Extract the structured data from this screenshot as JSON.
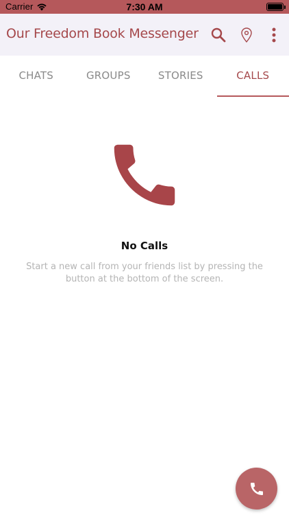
{
  "status_bar": {
    "carrier": "Carrier",
    "time": "7:30 AM"
  },
  "app_bar": {
    "title": "Our Freedom Book Messenger",
    "icons": [
      "search-icon",
      "location-pin-icon",
      "more-vert-icon"
    ]
  },
  "tabs": [
    {
      "label": "CHATS",
      "active": false
    },
    {
      "label": "GROUPS",
      "active": false
    },
    {
      "label": "STORIES",
      "active": false
    },
    {
      "label": "CALLS",
      "active": true
    }
  ],
  "empty_state": {
    "icon": "phone-icon",
    "title": "No Calls",
    "description": "Start a new call from your friends list by pressing the button at the bottom of the screen."
  },
  "fab": {
    "icon": "phone-icon"
  },
  "colors": {
    "status_bar": "#b5585b",
    "app_bar_bg": "#f3f1f8",
    "accent": "#a5484b",
    "tab_inactive": "#8a8a8a",
    "fab": "#b96567",
    "empty_icon": "#a84549"
  }
}
